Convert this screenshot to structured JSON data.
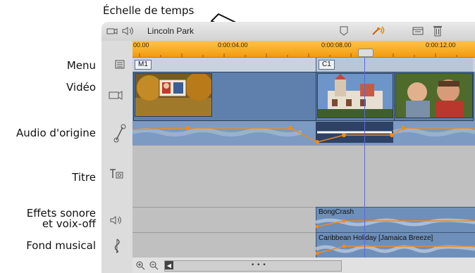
{
  "annotation": {
    "heading": "Échelle de temps"
  },
  "labels": {
    "menu": "Menu",
    "video": "Vidéo",
    "audio": "Audio d'origine",
    "title": "Titre",
    "sfx_line1": "Effets sonore",
    "sfx_line2": "et voix-off",
    "music": "Fond musical"
  },
  "toolbar": {
    "project_title": "Lincoln Park"
  },
  "ruler": {
    "ticks": [
      "00.00",
      "0:00:04.00",
      "0:00:08.00",
      "0:00:12.00"
    ]
  },
  "menu_track": {
    "markers": [
      "M1",
      "C1"
    ]
  },
  "sfx_track": {
    "clip": "BongCrash"
  },
  "music_track": {
    "clip": "Caribbean Holiday [Jamaica Breeze]"
  },
  "scrollbar": {
    "grip": "• • •"
  },
  "colors": {
    "ruler": "#f7a21a",
    "video_track": "#6f8fb8",
    "panel": "#c9c9c9"
  }
}
